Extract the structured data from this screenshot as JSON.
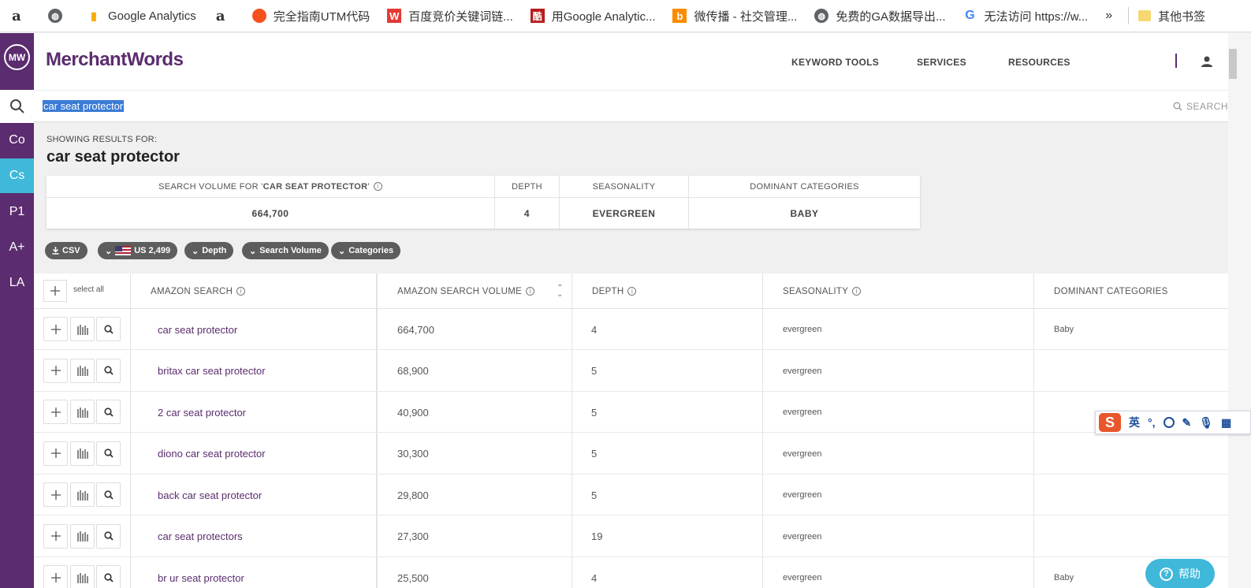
{
  "bookmarks": [
    {
      "icon": "amazon-icon",
      "label": ""
    },
    {
      "icon": "globe-icon",
      "label": ""
    },
    {
      "icon": "google-analytics-icon",
      "label": "Google Analytics"
    },
    {
      "icon": "amazon-icon",
      "label": ""
    },
    {
      "icon": "red-circle-icon",
      "label": "完全指南UTM代码"
    },
    {
      "icon": "w-icon",
      "label": "百度竞价关键词链..."
    },
    {
      "icon": "ku-icon",
      "label": "用Google Analytic..."
    },
    {
      "icon": "b-icon",
      "label": "微传播 - 社交管理..."
    },
    {
      "icon": "globe-icon",
      "label": "免费的GA数据导出..."
    },
    {
      "icon": "google-icon",
      "label": "无法访问 https://w..."
    }
  ],
  "bookmarks_more": "»",
  "bookmarks_other": "其他书签",
  "sidebar": {
    "logo": "MW",
    "items": [
      {
        "label": "Co",
        "active": false
      },
      {
        "label": "Cs",
        "active": true
      },
      {
        "label": "P1",
        "active": false
      },
      {
        "label": "A+",
        "active": false
      },
      {
        "label": "LA",
        "active": false
      }
    ]
  },
  "header": {
    "brand": "MerchantWords",
    "nav": [
      "KEYWORD TOOLS",
      "SERVICES",
      "RESOURCES"
    ]
  },
  "search": {
    "value": "car seat protector",
    "button_label": "SEARCH"
  },
  "results": {
    "showing_label": "SHOWING RESULTS FOR:",
    "term": "car seat protector"
  },
  "summary": {
    "headers": {
      "volume_prefix": "SEARCH VOLUME FOR '",
      "volume_term": "CAR SEAT PROTECTOR",
      "volume_suffix": "'",
      "depth": "DEPTH",
      "seasonality": "SEASONALITY",
      "categories": "DOMINANT CATEGORIES"
    },
    "values": {
      "volume": "664,700",
      "depth": "4",
      "seasonality": "EVERGREEN",
      "categories": "BABY"
    }
  },
  "filters": {
    "csv": "CSV",
    "country": "US 2,499",
    "depth": "Depth",
    "volume": "Search Volume",
    "categories": "Categories"
  },
  "table": {
    "select_all": "select all",
    "columns": {
      "search": "AMAZON SEARCH",
      "volume": "AMAZON SEARCH VOLUME",
      "depth": "DEPTH",
      "seasonality": "SEASONALITY",
      "categories": "DOMINANT CATEGORIES"
    },
    "rows": [
      {
        "keyword": "car seat protector",
        "volume": "664,700",
        "depth": "4",
        "seasonality": "evergreen",
        "category": "Baby"
      },
      {
        "keyword": "britax car seat protector",
        "volume": "68,900",
        "depth": "5",
        "seasonality": "evergreen",
        "category": ""
      },
      {
        "keyword": "2 car seat protector",
        "volume": "40,900",
        "depth": "5",
        "seasonality": "evergreen",
        "category": ""
      },
      {
        "keyword": "diono car seat protector",
        "volume": "30,300",
        "depth": "5",
        "seasonality": "evergreen",
        "category": ""
      },
      {
        "keyword": "back car seat protector",
        "volume": "29,800",
        "depth": "5",
        "seasonality": "evergreen",
        "category": ""
      },
      {
        "keyword": "car seat protectors",
        "volume": "27,300",
        "depth": "19",
        "seasonality": "evergreen",
        "category": ""
      },
      {
        "keyword": "br   ur seat protector",
        "volume": "25,500",
        "depth": "4",
        "seasonality": "evergreen",
        "category": "Baby"
      }
    ]
  },
  "ime": {
    "logo": "S",
    "lang": "英",
    "punct": "°,"
  },
  "help": {
    "label": "帮助"
  },
  "colors": {
    "brand_purple": "#5b2c6f",
    "accent_cyan": "#3fb8d9",
    "pill_gray": "#5d5d5d"
  }
}
